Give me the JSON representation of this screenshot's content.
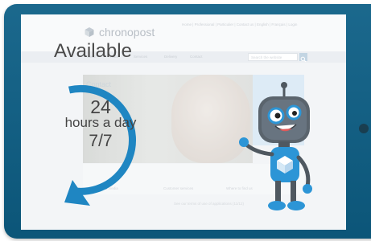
{
  "website": {
    "logo_text": "chronopost",
    "top_links": "Home | Professional | Particulier | Contact us | English | Français | Login",
    "nav_items": [
      "Send",
      "Track",
      "Services",
      "Delivery",
      "Contact"
    ],
    "search_placeholder": "Search the website",
    "contact_title": "Contact",
    "feature_labels": [
      "Social media",
      "Customer services",
      "Where to find us"
    ],
    "footer_link": "See our terms of use of applications (11/12)"
  },
  "overlay": {
    "headline": "Available",
    "hours_number": "24",
    "hours_text": "hours a day",
    "days_text": "7/7"
  },
  "colors": {
    "tablet_frame": "#0d5f86",
    "arrow": "#1f86c2",
    "robot_blue": "#2c95d6",
    "robot_gray": "#4f5860"
  },
  "icons": {
    "logo": "chronopost-cube-logo-icon",
    "arrow": "circular-arrow-icon",
    "mascot": "robot-mascot-icon",
    "search": "search-icon"
  }
}
